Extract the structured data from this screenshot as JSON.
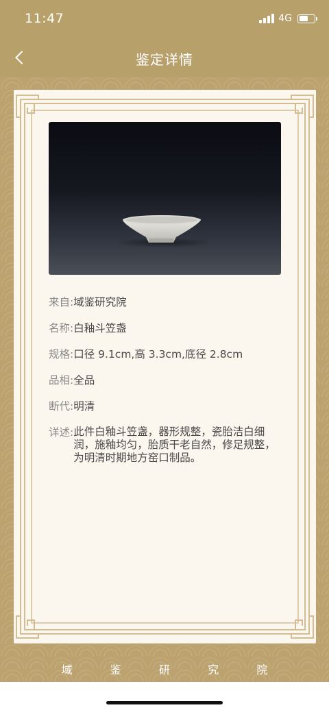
{
  "status_bar": {
    "time": "11:47",
    "network": "4G",
    "battery_level": 0.6
  },
  "nav": {
    "title": "鉴定详情"
  },
  "details": {
    "from_label": "来自:",
    "from_value": "域鉴研究院",
    "name_label": "名称:",
    "name_value": "白釉斗笠盏",
    "spec_label": "规格:",
    "spec_value": "口径 9.1cm,高 3.3cm,底径 2.8cm",
    "condition_label": "品相:",
    "condition_value": "全品",
    "dating_label": "断代:",
    "dating_value": "明清",
    "description_label": "详述:",
    "description_value": "此件白釉斗笠盏，器形规整，瓷胎洁白细润，施釉均匀，胎质干老自然，修足规整，为明清时期地方窑口制品。"
  },
  "footer": {
    "chars": [
      "域",
      "鉴",
      "研",
      "究",
      "院"
    ]
  },
  "colors": {
    "header_gold": "#b8a06a",
    "card_bg": "#fbf6ee",
    "frame_line": "#d2bd93"
  }
}
